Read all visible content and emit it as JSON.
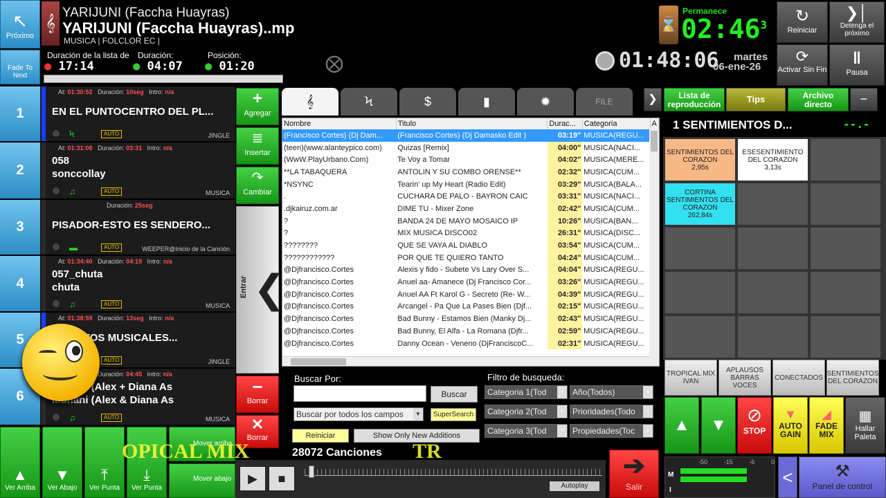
{
  "now_playing": {
    "title_line1": "YARIJUNI (Faccha Huayras)",
    "title_line2": "YARIJUNI (Faccha Huayras)..mp",
    "tags": "MUSICA | FOLCLOR EC |",
    "next_label": "Próximo",
    "fade_label": "Fade To Next",
    "list_duration_label": "Duración de la lista de",
    "list_duration": "17:14",
    "duration_label": "Duración:",
    "duration": "04:07",
    "position_label": "Posición:",
    "position": "01:20"
  },
  "clock": {
    "remain_label": "Permanece",
    "remain": "02:46",
    "remain_sub": "3",
    "time": "01:48:06",
    "day": "martes",
    "date": "06-ene-26"
  },
  "top_buttons": {
    "restart": "Reiniciar",
    "stop_next": "Detenga el próximo",
    "activate_endless": "Activar Sin Fin",
    "pause": "Pausa"
  },
  "queue": [
    {
      "num": "1",
      "at": "01:30:52",
      "duration": "10seg",
      "intro": "n/a",
      "title": "EN EL PUNTOCENTRO DEL PL...",
      "title2": "",
      "category": "JINGLE",
      "auto": "AUTO",
      "bar": "#1a3cff"
    },
    {
      "num": "2",
      "at": "01:31:08",
      "duration": "03:31",
      "intro": "n/a",
      "title": "058",
      "title2": "sonccollay",
      "category": "MUSICA",
      "auto": "AUTO",
      "bar": "#2a2a2a"
    },
    {
      "num": "3",
      "at": "",
      "duration": "25seg",
      "intro": "",
      "title": "PISADOR-ESTO ES SENDERO...",
      "title2": "",
      "category": "WEEPER@Inicio de la Canción",
      "auto": "AUTO",
      "bar": "#2a2a2a"
    },
    {
      "num": "4",
      "at": "01:34:40",
      "duration": "04:19",
      "intro": "n/a",
      "title": "057_chuta",
      "title2": "chuta",
      "category": "MUSICA",
      "auto": "AUTO",
      "bar": "#2a2a2a"
    },
    {
      "num": "5",
      "at": "01:38:59",
      "duration": "13seg",
      "intro": "n/a",
      "title": "NAEXITOS MUSICALES...",
      "title2": "",
      "category": "JINGLE",
      "auto": "AUTO",
      "bar": "#1a3cff"
    },
    {
      "num": "6",
      "at": "01:39:12",
      "duration": "04:45",
      "intro": "n/a",
      "title": "Munani (Alex + Diana As",
      "title2": "Munani (Alex & Diana As",
      "category": "MUSICA",
      "auto": "AUTO",
      "bar": "#2a2a2a"
    }
  ],
  "queue_labels": {
    "at": "At:",
    "duration": "Duración:",
    "intro": "Intro:"
  },
  "side_buttons": {
    "add": "Agregar",
    "insert": "Insertar",
    "change": "Cambiar",
    "enter": "Entrar",
    "delete": "Borrar",
    "delete_all": "Borrar"
  },
  "tabs": [
    "music",
    "jingle",
    "commercial",
    "voice",
    "fx",
    "FILE"
  ],
  "right_tabs": {
    "playlist": "Lista de reproducción",
    "tips": "Tips",
    "file": "Archivo directo"
  },
  "table": {
    "columns": [
      "Nombre",
      "Titulo",
      "Durac...",
      "Categoria",
      "A"
    ],
    "rows": [
      [
        "(Francisco Cortes) (Dj Dam...",
        "(Francisco Cortes) (Dj Damasko Edit )",
        "03:19\"",
        "MUSICA(REGU..."
      ],
      [
        "(teen)(www.alanteypico.com)",
        "Quizas [Remix]",
        "04:00\"",
        "MUSICA(NACI..."
      ],
      [
        "(WwW.PlayUrbano.Com)",
        "Te Voy a Tomar",
        "04:02\"",
        "MUSICA(MERE..."
      ],
      [
        "**LA TABAQUERA",
        "ANTOLIN Y SU COMBO ORENSE**",
        "02:32\"",
        "MUSICA(CUM..."
      ],
      [
        "*NSYNC",
        "Tearin' up My Heart (Radio Edit)",
        "03:29\"",
        "MUSICA(BALA..."
      ],
      [
        ".",
        "CUCHARA DE PALO - BAYRON CAIC",
        "03:31\"",
        "MUSICA(NACI..."
      ],
      [
        ".djkairuz.com.ar",
        "DIME TU - Mixer Zone",
        "02:42\"",
        "MUSICA(CUM..."
      ],
      [
        "?",
        "BANDA 24 DE MAYO MOSAICO IP",
        "10:26\"",
        "MUSICA(BAN..."
      ],
      [
        "?",
        "MIX MUSICA DISCO02",
        "26:31\"",
        "MUSICA(DISC..."
      ],
      [
        "????????",
        "QUE SE VAYA AL DIABLO",
        "03:54\"",
        "MUSICA(CUM..."
      ],
      [
        "????????????",
        "POR QUE TE QUIERO TANTO",
        "04:24\"",
        "MUSICA(CUM..."
      ],
      [
        "@Djfrancisco.Cortes",
        "Alexis y fido - Subete Vs Lary Over S...",
        "04:04\"",
        "MUSICA(REGU..."
      ],
      [
        "@Djfrancisco.Cortes",
        "Anuel aa- Amanece (Dj Francisco Cor...",
        "03:26\"",
        "MUSICA(REGU..."
      ],
      [
        "@Djfrancisco.Cortes",
        "Anuel AA Ft Karol G - Secreto (Re- W...",
        "04:39\"",
        "MUSICA(REGU..."
      ],
      [
        "@Djfrancisco.Cortes",
        "Arcangel - Pa Que La Pases Bien (Djf...",
        "02:15\"",
        "MUSICA(REGU..."
      ],
      [
        "@Djfrancisco.Cortes",
        "Bad Bunny - Estamos Bien (Manky Dj...",
        "02:43\"",
        "MUSICA(REGU..."
      ],
      [
        "@Djfrancisco.Cortes",
        "Bad Bunny, El Alfa - La Romana (Djfr...",
        "02:59\"",
        "MUSICA(REGU..."
      ],
      [
        "@Djfrancisco.Cortes",
        "Danny Ocean - Veneno (DjFranciscoC...",
        "02:31\"",
        "MUSICA(REGU..."
      ]
    ]
  },
  "search": {
    "label": "Buscar Por:",
    "button": "Buscar",
    "mode": "Buscar por todos los campos",
    "super": "SuperSearch",
    "reset": "Reiniciar",
    "show_new": "Show Only New Additions",
    "count": "28072 Canciones",
    "filter_label": "Filtro de busqueda:",
    "cat1": "Categoria 1(Tod",
    "cat2": "Categoria 2(Tod",
    "cat3": "Categoria 3(Tod",
    "year": "Año(Todos)",
    "prio": "Prioridades(Todo",
    "props": "Propiedades(Toc"
  },
  "panel": {
    "title": "1  SENTIMIENTOS D...",
    "indicator": "--.-",
    "cells": [
      {
        "name": "SENTIMIENTOS DEL CORAZON",
        "dur": "2,95s",
        "color": "#f7b887"
      },
      {
        "name": "ESESENTIMIENTO DEL CORAZON",
        "dur": "3,13s",
        "color": "#ffffff"
      },
      {
        "name": "CORTINA SENTIMIENTOS DEL CORAZON",
        "dur": "262,84s",
        "color": "#33e0ef"
      }
    ],
    "bottom_tabs": [
      "TROPICAL MIX IVAN",
      "APLAUSOS BARRAS VOCES",
      "CONECTADOS",
      "SENTIMIENTOS DEL CORAZON"
    ]
  },
  "bottom_controls": {
    "up": "Ver Arriba",
    "down": "Ver Abajo",
    "point": "Ver Punta",
    "point2": "Ver Punta",
    "move_up": "Mover arriba",
    "move_down": "Mover abajo",
    "stop": "STOP",
    "autogain": "AUTO GAIN",
    "fademix": "FADE MIX",
    "find_pal": "Hallar Paleta",
    "exit": "Salir",
    "autoplay": "Autoplay",
    "control_panel": "Panel de control",
    "meter_m": "M",
    "meter_i": "I",
    "meter_scale": [
      "-50",
      "-15",
      "-6",
      "0"
    ]
  },
  "overlay": {
    "text1": "OPICAL  MIX",
    "text2": "TR"
  }
}
